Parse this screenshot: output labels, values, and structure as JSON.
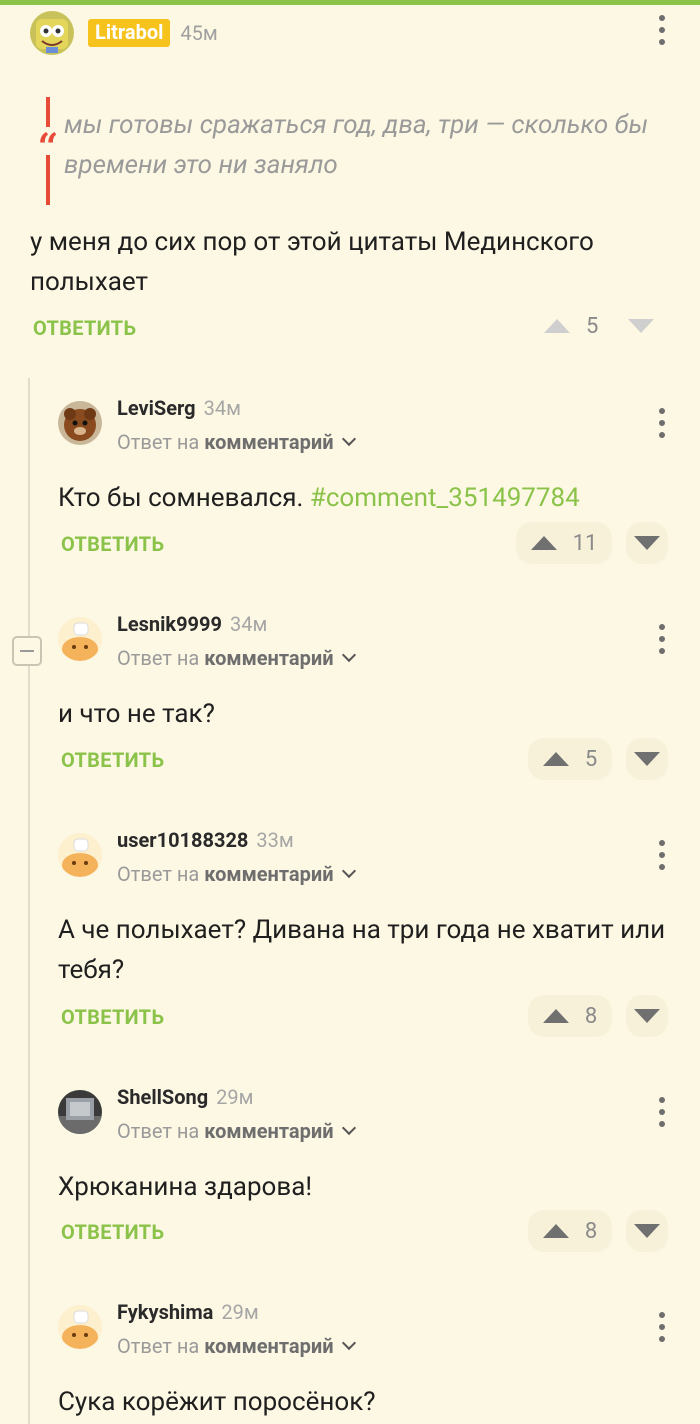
{
  "top_comment": {
    "author": "Litrabol",
    "time": "45м",
    "quote": "мы готовы сражаться год, два, три — сколько бы времени это ни заняло",
    "text": "у меня до сих пор от этой цитаты Мединского полыхает",
    "reply_label": "ОТВЕТИТЬ",
    "score": "5"
  },
  "common": {
    "reply_prefix": "Ответ на",
    "reply_target": "комментарий",
    "reply_label": "ОТВЕТИТЬ"
  },
  "replies": [
    {
      "author": "LeviSerg",
      "time": "34м",
      "text": "Кто бы сомневался.",
      "tag": "#comment_351497784",
      "score": "11"
    },
    {
      "author": "Lesnik9999",
      "time": "34м",
      "text": "и что не так?",
      "score": "5"
    },
    {
      "author": "user10188328",
      "time": "33м",
      "text": "А че полыхает? Дивана на три года не хватит или тебя?",
      "score": "8"
    },
    {
      "author": "ShellSong",
      "time": "29м",
      "text": "Хрюканина здарова!",
      "score": "8"
    },
    {
      "author": "Fykyshima",
      "time": "29м",
      "text": "Сука корёжит поросёнок?"
    }
  ],
  "colors": {
    "accent": "#8bc34a",
    "quote_bar": "#e84a3a",
    "badge": "#f6c21c",
    "background": "#fdf8e4"
  }
}
